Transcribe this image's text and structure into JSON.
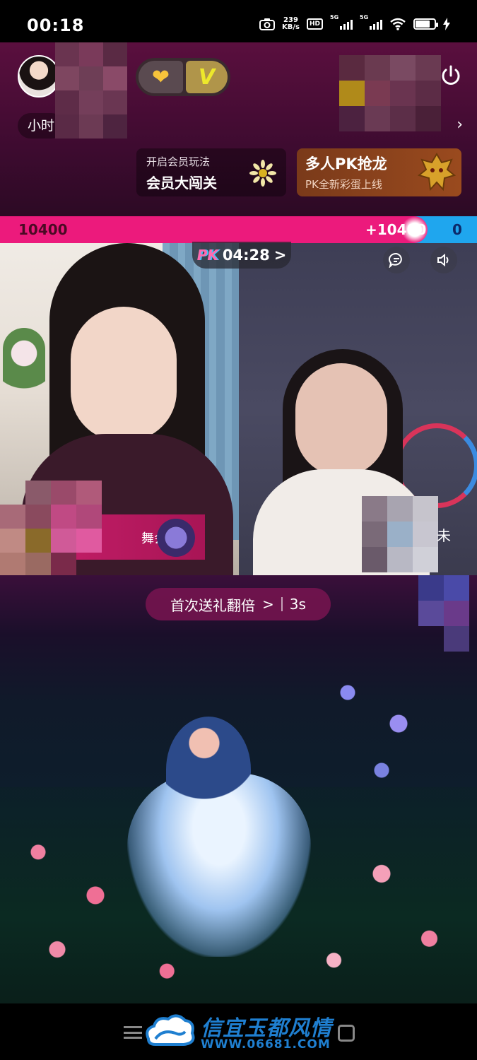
{
  "status_bar": {
    "time": "00:18",
    "net_speed_value": "239",
    "net_speed_unit": "KB/s",
    "hd_label": "HD",
    "sim1_label": "5G",
    "sim2_label": "5G"
  },
  "header": {
    "host_name": "小时",
    "name_arrow": "›",
    "member_promo": {
      "line1": "开启会员玩法",
      "line2": "会员大闯关"
    },
    "pk_promo": {
      "line1": "多人PK抢龙",
      "line2": "PK全新彩蛋上线"
    },
    "badge_v": "V"
  },
  "pk_bar": {
    "left_score": "10400",
    "mid_score": "+10400",
    "right_score": "0",
    "colors": {
      "left": "#ec1a7c",
      "right": "#1fa6ee"
    }
  },
  "pk_timer": {
    "logo": "PK",
    "time": "04:28",
    "arrow": ">"
  },
  "video": {
    "left_tag": "舞会",
    "right_name_tail": "未"
  },
  "gift_banner": {
    "text": "首次送礼翻倍",
    "arrow": ">",
    "countdown": "3s"
  },
  "watermark": {
    "title": "信宜玉都风情",
    "url": "WWW.06681.COM"
  }
}
